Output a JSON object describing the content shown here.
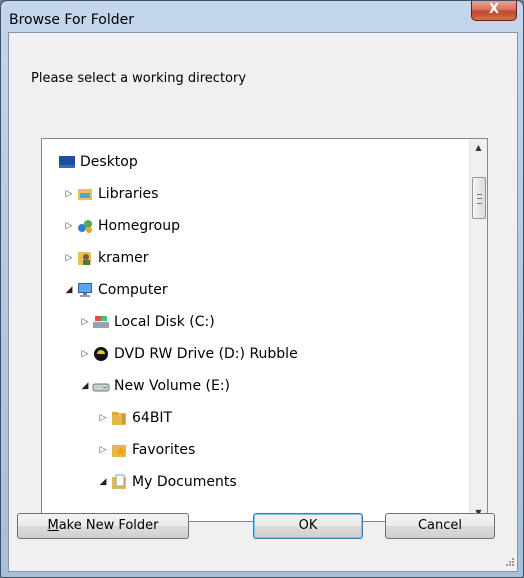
{
  "dialog": {
    "title": "Browse For Folder",
    "close_label": "X",
    "prompt": "Please select a working directory"
  },
  "tree": [
    {
      "label": "Desktop",
      "icon": "desktop-icon",
      "expander": ""
    },
    {
      "label": "Libraries",
      "icon": "libraries-icon",
      "expander": "collapsed"
    },
    {
      "label": "Homegroup",
      "icon": "homegroup-icon",
      "expander": "collapsed"
    },
    {
      "label": "kramer",
      "icon": "user-folder-icon",
      "expander": "collapsed"
    },
    {
      "label": "Computer",
      "icon": "computer-icon",
      "expander": "expanded"
    },
    {
      "label": "Local Disk (C:)",
      "icon": "local-disk-icon",
      "expander": "collapsed"
    },
    {
      "label": "DVD RW Drive (D:) Rubble",
      "icon": "dvd-drive-icon",
      "expander": "collapsed"
    },
    {
      "label": "New Volume (E:)",
      "icon": "hard-drive-icon",
      "expander": "expanded"
    },
    {
      "label": "64BIT",
      "icon": "folder-icon",
      "expander": "collapsed"
    },
    {
      "label": "Favorites",
      "icon": "favorites-folder-icon",
      "expander": "collapsed"
    },
    {
      "label": "My Documents",
      "icon": "documents-folder-icon",
      "expander": "expanded"
    }
  ],
  "buttons": {
    "make_new_folder": "Make New Folder",
    "make_new_folder_mnemonic": "M",
    "make_new_folder_rest": "ake New Folder",
    "ok": "OK",
    "cancel": "Cancel"
  }
}
